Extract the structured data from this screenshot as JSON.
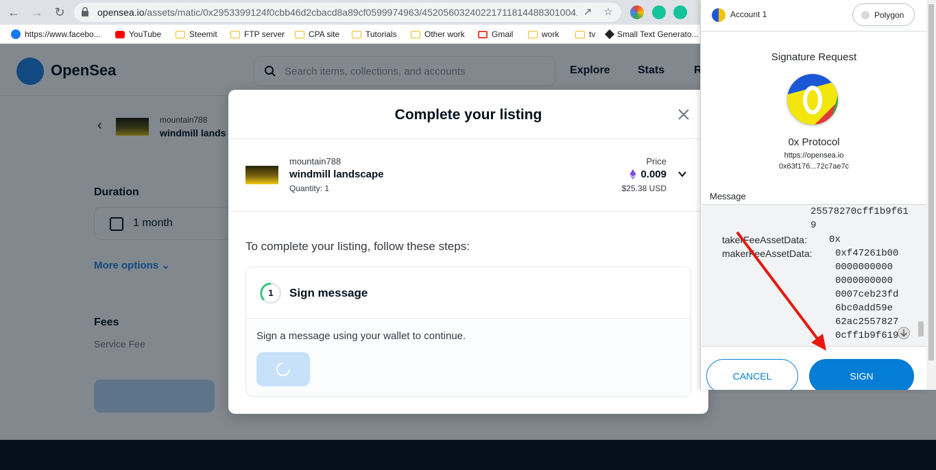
{
  "browser": {
    "url_main": "opensea.io",
    "url_rest": "/assets/matic/0x2953399124f0cbb46d2cbacd8a89cf0599974963/45205603240221711814488301004...",
    "bookmarks": [
      {
        "label": "https://www.facebo..."
      },
      {
        "label": "YouTube"
      },
      {
        "label": "Steemit"
      },
      {
        "label": "FTP server"
      },
      {
        "label": "CPA site"
      },
      {
        "label": "Tutorials"
      },
      {
        "label": "Other work"
      },
      {
        "label": "Gmail"
      },
      {
        "label": "work"
      },
      {
        "label": "tv"
      },
      {
        "label": "Small Text Generato..."
      }
    ]
  },
  "opensea": {
    "brand": "OpenSea",
    "search_placeholder": "Search items, collections, and accounts",
    "nav": [
      "Explore",
      "Stats",
      "R"
    ],
    "bg_owner": "mountain788",
    "bg_title": "windmill lands",
    "duration_label": "Duration",
    "duration_value": "1 month",
    "more_options": "More options",
    "fees_label": "Fees",
    "service_fee": "Service Fee"
  },
  "modal": {
    "title": "Complete your listing",
    "item_owner": "mountain788",
    "item_name": "windmill landscape",
    "quantity": "Quantity: 1",
    "price_label": "Price",
    "price_value": "0.009",
    "price_usd": "$25.38 USD",
    "steps_intro": "To complete your listing, follow these steps:",
    "step_number": "1",
    "step_title": "Sign message",
    "step_desc": "Sign a message using your wallet to continue."
  },
  "metamask": {
    "account": "Account 1",
    "network": "Polygon",
    "title": "Signature Request",
    "protocol": "0x Protocol",
    "origin": "https://opensea.io",
    "address": "0x63f176...72c7ae7c",
    "message_label": "Message",
    "msg_line1": "25578270cff1b9f61",
    "msg_line2": "9",
    "taker_key": "takerFeeAssetData:",
    "taker_val": "0x",
    "maker_key": "makerFeeAssetData:",
    "maker_vals": [
      "0xf47261b00",
      "0000000000",
      "0000000000",
      "0007ceb23fd",
      "6bc0add59e",
      "62ac2557827",
      "0cff1b9f619"
    ],
    "cancel": "CANCEL",
    "sign": "SIGN"
  },
  "colors": {
    "accent": "#2081e2",
    "metamask_blue": "#037dd6",
    "annotation_arrow": "#e8170f"
  }
}
